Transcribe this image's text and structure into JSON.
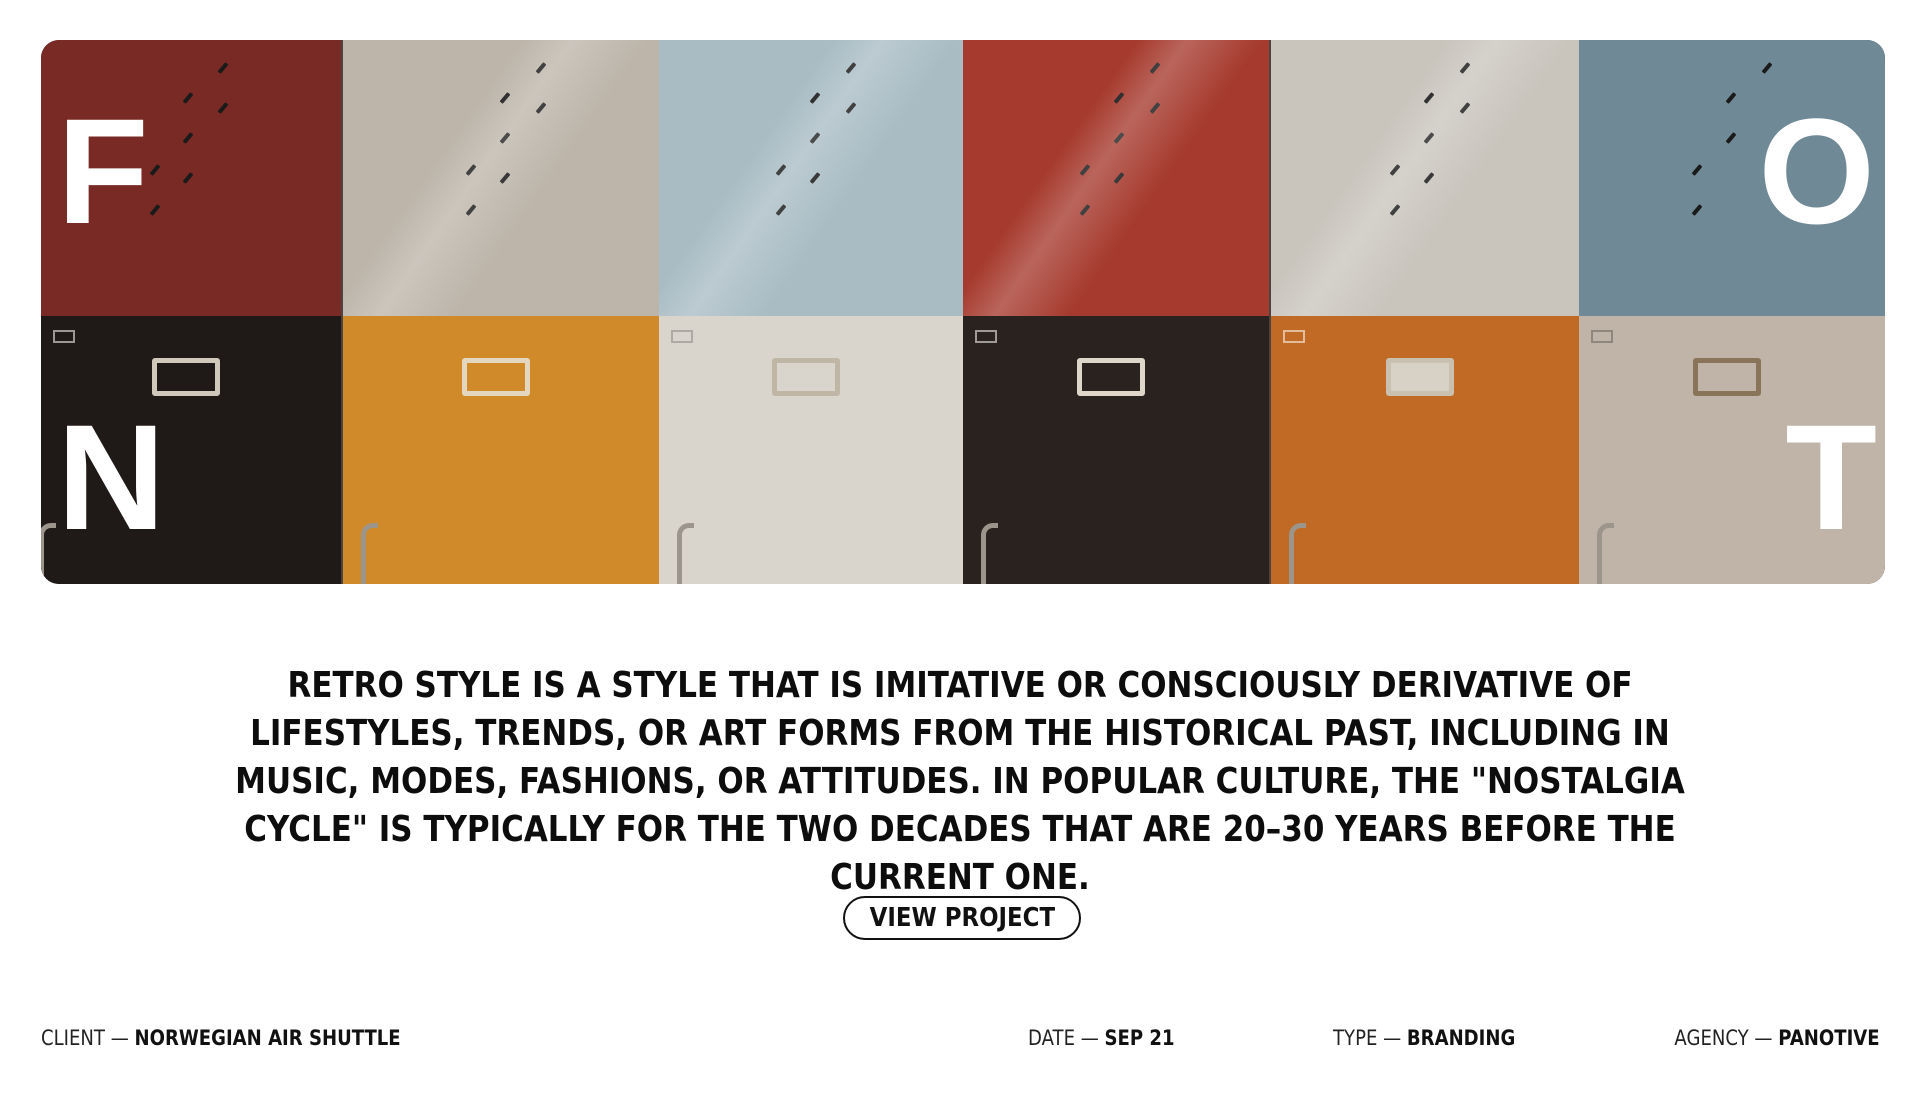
{
  "hero": {
    "letters": {
      "top_left": "F",
      "bottom_left": "N",
      "top_right": "O",
      "bottom_right": "T"
    },
    "locker_colors": {
      "top": [
        "#7a2a24",
        "#bdb5aa",
        "#a9bcc4",
        "#a63a2e",
        "#c9c5bd",
        "#6f8a96"
      ],
      "bottom": [
        "#1f1a17",
        "#d18a2a",
        "#d9d4cc",
        "#2a221e",
        "#c06a25",
        "#bfb4a7"
      ]
    }
  },
  "description": "RETRO STYLE IS A STYLE THAT IS IMITATIVE OR CONSCIOUSLY DERIVATIVE OF LIFESTYLES, TRENDS, OR ART FORMS FROM THE HISTORICAL PAST, INCLUDING IN MUSIC, MODES, FASHIONS, OR ATTITUDES. IN POPULAR CULTURE, THE \"NOSTALGIA CYCLE\" IS TYPICALLY FOR THE TWO DECADES THAT ARE 20–30 YEARS BEFORE THE CURRENT ONE.",
  "cta": {
    "label": "VIEW PROJECT"
  },
  "meta": {
    "client": {
      "key": "CLIENT —",
      "value": "NORWEGIAN AIR SHUTTLE"
    },
    "date": {
      "key": "DATE —",
      "value": "SEP 21"
    },
    "type": {
      "key": "TYPE —",
      "value": "BRANDING"
    },
    "agency": {
      "key": "AGENCY —",
      "value": "PANOTIVE"
    }
  }
}
